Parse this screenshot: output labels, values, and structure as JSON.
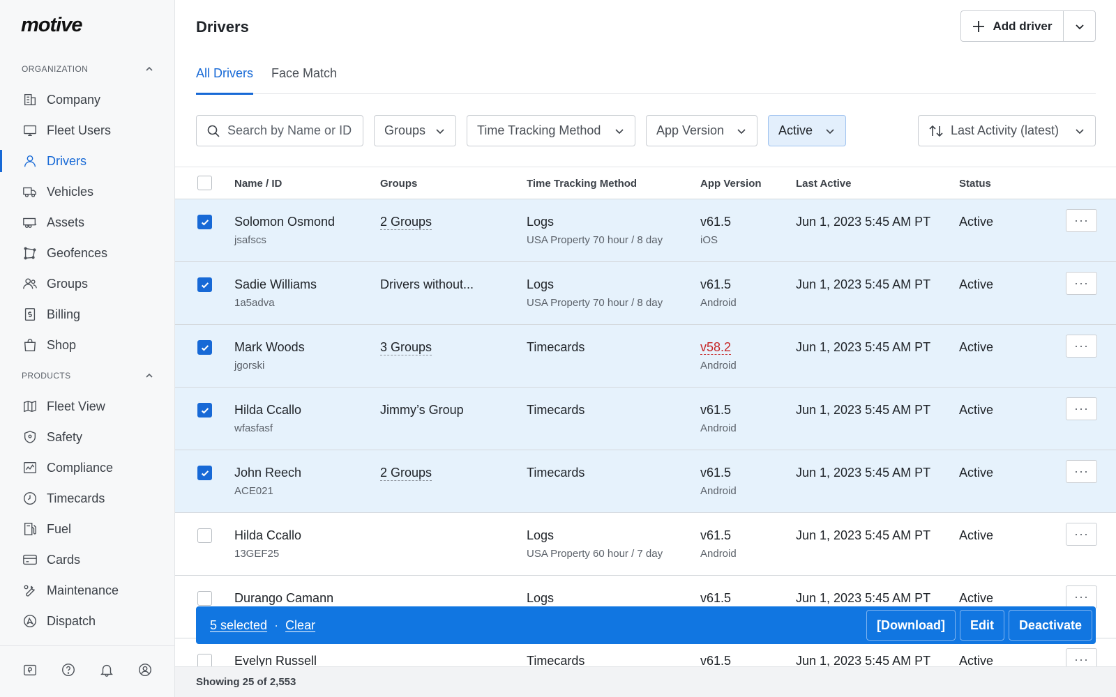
{
  "brand": "motive",
  "sidebar": {
    "sections": [
      {
        "label": "ORGANIZATION",
        "items": [
          {
            "label": "Company",
            "icon": "building-icon"
          },
          {
            "label": "Fleet Users",
            "icon": "monitor-icon"
          },
          {
            "label": "Drivers",
            "icon": "user-icon",
            "active": true
          },
          {
            "label": "Vehicles",
            "icon": "truck-icon"
          },
          {
            "label": "Assets",
            "icon": "trailer-icon"
          },
          {
            "label": "Geofences",
            "icon": "geofence-icon"
          },
          {
            "label": "Groups",
            "icon": "users-icon"
          },
          {
            "label": "Billing",
            "icon": "billing-icon"
          },
          {
            "label": "Shop",
            "icon": "shopping-bag-icon"
          }
        ]
      },
      {
        "label": "PRODUCTS",
        "items": [
          {
            "label": "Fleet View",
            "icon": "map-icon"
          },
          {
            "label": "Safety",
            "icon": "shield-icon"
          },
          {
            "label": "Compliance",
            "icon": "compliance-icon"
          },
          {
            "label": "Timecards",
            "icon": "clock-icon"
          },
          {
            "label": "Fuel",
            "icon": "fuel-icon"
          },
          {
            "label": "Cards",
            "icon": "card-icon"
          },
          {
            "label": "Maintenance",
            "icon": "wrench-icon"
          },
          {
            "label": "Dispatch",
            "icon": "dispatch-icon"
          }
        ]
      }
    ]
  },
  "header": {
    "title": "Drivers",
    "add_button": "Add driver"
  },
  "tabs": [
    {
      "label": "All Drivers",
      "active": true
    },
    {
      "label": "Face Match",
      "active": false
    }
  ],
  "filters": {
    "search_placeholder": "Search by Name or ID",
    "groups": "Groups",
    "time_tracking": "Time Tracking Method",
    "app_version": "App Version",
    "status": "Active",
    "sort": "Last Activity (latest)"
  },
  "table": {
    "columns": [
      "Name / ID",
      "Groups",
      "Time Tracking Method",
      "App Version",
      "Last Active",
      "Status"
    ],
    "rows": [
      {
        "selected": true,
        "name": "Solomon Osmond",
        "id": "jsafscs",
        "groups": "2 Groups",
        "groups_link": true,
        "method": "Logs",
        "method_sub": "USA Property 70 hour / 8 day",
        "version": "v61.5",
        "version_warn": false,
        "platform": "iOS",
        "last_active": "Jun 1, 2023 5:45 AM PT",
        "status": "Active"
      },
      {
        "selected": true,
        "name": "Sadie Williams",
        "id": "1a5adva",
        "groups": "Drivers without...",
        "groups_link": false,
        "method": "Logs",
        "method_sub": "USA Property 70 hour / 8 day",
        "version": "v61.5",
        "version_warn": false,
        "platform": "Android",
        "last_active": "Jun 1, 2023 5:45 AM PT",
        "status": "Active"
      },
      {
        "selected": true,
        "name": "Mark Woods",
        "id": "jgorski",
        "groups": "3 Groups",
        "groups_link": true,
        "method": "Timecards",
        "method_sub": "",
        "version": "v58.2",
        "version_warn": true,
        "platform": "Android",
        "last_active": "Jun 1, 2023 5:45 AM PT",
        "status": "Active"
      },
      {
        "selected": true,
        "name": "Hilda Ccallo",
        "id": "wfasfasf",
        "groups": "Jimmy’s Group",
        "groups_link": false,
        "method": "Timecards",
        "method_sub": "",
        "version": "v61.5",
        "version_warn": false,
        "platform": "Android",
        "last_active": "Jun 1, 2023 5:45 AM PT",
        "status": "Active"
      },
      {
        "selected": true,
        "name": "John Reech",
        "id": "ACE021",
        "groups": "2 Groups",
        "groups_link": true,
        "method": "Timecards",
        "method_sub": "",
        "version": "v61.5",
        "version_warn": false,
        "platform": "Android",
        "last_active": "Jun 1, 2023 5:45 AM PT",
        "status": "Active"
      },
      {
        "selected": false,
        "name": "Hilda Ccallo",
        "id": "13GEF25",
        "groups": "",
        "groups_link": false,
        "method": "Logs",
        "method_sub": "USA Property 60 hour / 7 day",
        "version": "v61.5",
        "version_warn": false,
        "platform": "Android",
        "last_active": "Jun 1, 2023 5:45 AM PT",
        "status": "Active"
      },
      {
        "selected": false,
        "name": "Durango Camann",
        "id": "",
        "groups": "",
        "groups_link": false,
        "method": "Logs",
        "method_sub": "",
        "version": "v61.5",
        "version_warn": false,
        "platform": "",
        "last_active": "Jun 1, 2023 5:45 AM PT",
        "status": "Active"
      },
      {
        "selected": false,
        "name": "Evelyn Russell",
        "id": "",
        "groups": "",
        "groups_link": false,
        "method": "Timecards",
        "method_sub": "",
        "version": "v61.5",
        "version_warn": false,
        "platform": "",
        "last_active": "Jun 1, 2023 5:45 AM PT",
        "status": "Active"
      }
    ]
  },
  "selection_bar": {
    "count": "5 selected",
    "clear": "Clear",
    "separator": "·",
    "download": "[Download]",
    "edit": "Edit",
    "deactivate": "Deactivate"
  },
  "footer": {
    "showing": "Showing 25 of 2,553"
  },
  "colors": {
    "accent": "#1769d6",
    "selection_bar": "#1176e1",
    "selected_row": "#e6f2fc",
    "warning": "#c62828"
  }
}
